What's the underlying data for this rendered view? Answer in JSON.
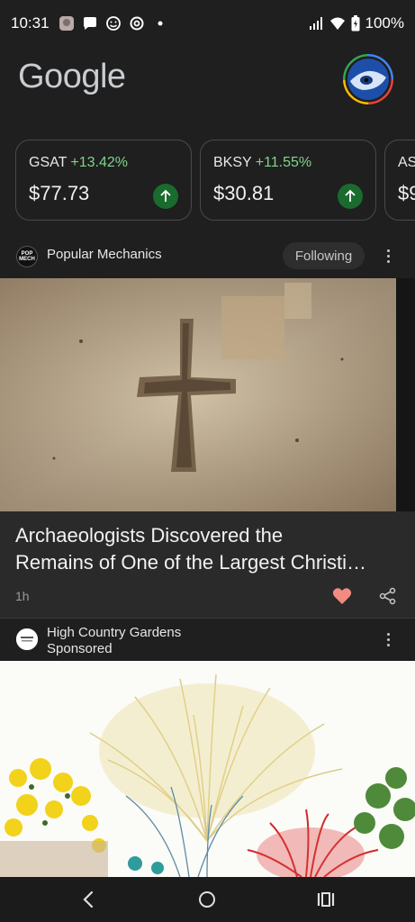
{
  "status_bar": {
    "time": "10:31",
    "battery": "100%",
    "icons": [
      "photo-thumb-icon",
      "message-icon",
      "face-icon",
      "threads-icon",
      "dot-icon",
      "signal-icon",
      "wifi-icon",
      "battery-icon"
    ]
  },
  "header": {
    "logo_text": "Google",
    "avatar_icon": "profile-avatar"
  },
  "stocks": [
    {
      "symbol": "GSAT",
      "change": "+13.42%",
      "price": "$77.73"
    },
    {
      "symbol": "BKSY",
      "change": "+11.55%",
      "price": "$30.81"
    },
    {
      "symbol": "AS",
      "change": "",
      "price": "$9"
    }
  ],
  "article": {
    "source": "Popular Mechanics",
    "source_logo_text": "POP MECH",
    "follow_label": "Following",
    "title_line1": "Archaeologists Discovered the",
    "title_line2": "Remains of One of the Largest Christi…",
    "time": "1h"
  },
  "sponsored": {
    "name": "High Country Gardens",
    "label": "Sponsored"
  },
  "colors": {
    "background": "#1f1f1f",
    "positive": "#7fd48a",
    "up_badge": "#1a6b2e",
    "heart": "#f28b82"
  }
}
